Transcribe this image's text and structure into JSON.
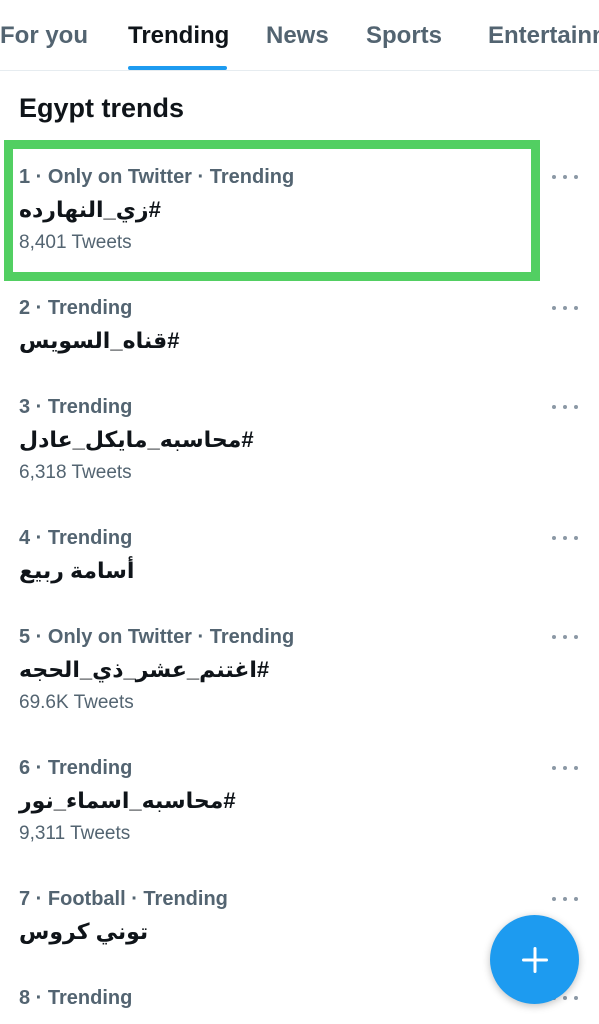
{
  "tabs": [
    {
      "label": "For you",
      "active": false
    },
    {
      "label": "Trending",
      "active": true
    },
    {
      "label": "News",
      "active": false
    },
    {
      "label": "Sports",
      "active": false
    },
    {
      "label": "Entertainm",
      "active": false
    }
  ],
  "section_title": "Egypt trends",
  "trends": [
    {
      "meta": "1 · Only on Twitter · Trending",
      "name": "#زي_النهارده",
      "count": "8,401 Tweets"
    },
    {
      "meta": "2 · Trending",
      "name": "#قناه_السويس",
      "count": ""
    },
    {
      "meta": "3 · Trending",
      "name": "#محاسبه_مايكل_عادل",
      "count": "6,318 Tweets"
    },
    {
      "meta": "4 · Trending",
      "name": "أسامة ربيع",
      "count": ""
    },
    {
      "meta": "5 · Only on Twitter · Trending",
      "name": "#اغتنم_عشر_ذي_الحجه",
      "count": "69.6K Tweets"
    },
    {
      "meta": "6 · Trending",
      "name": "#محاسبه_اسماء_نور",
      "count": "9,311 Tweets"
    },
    {
      "meta": "7 · Football · Trending",
      "name": "توني كروس",
      "count": ""
    },
    {
      "meta": "8 · Trending",
      "name": "",
      "count": ""
    }
  ],
  "colors": {
    "accent": "#1d9bf0",
    "highlight": "#52cf62",
    "secondary_text": "#536471"
  },
  "icons": {
    "more": "more-horizontal-icon",
    "compose": "plus-icon"
  }
}
